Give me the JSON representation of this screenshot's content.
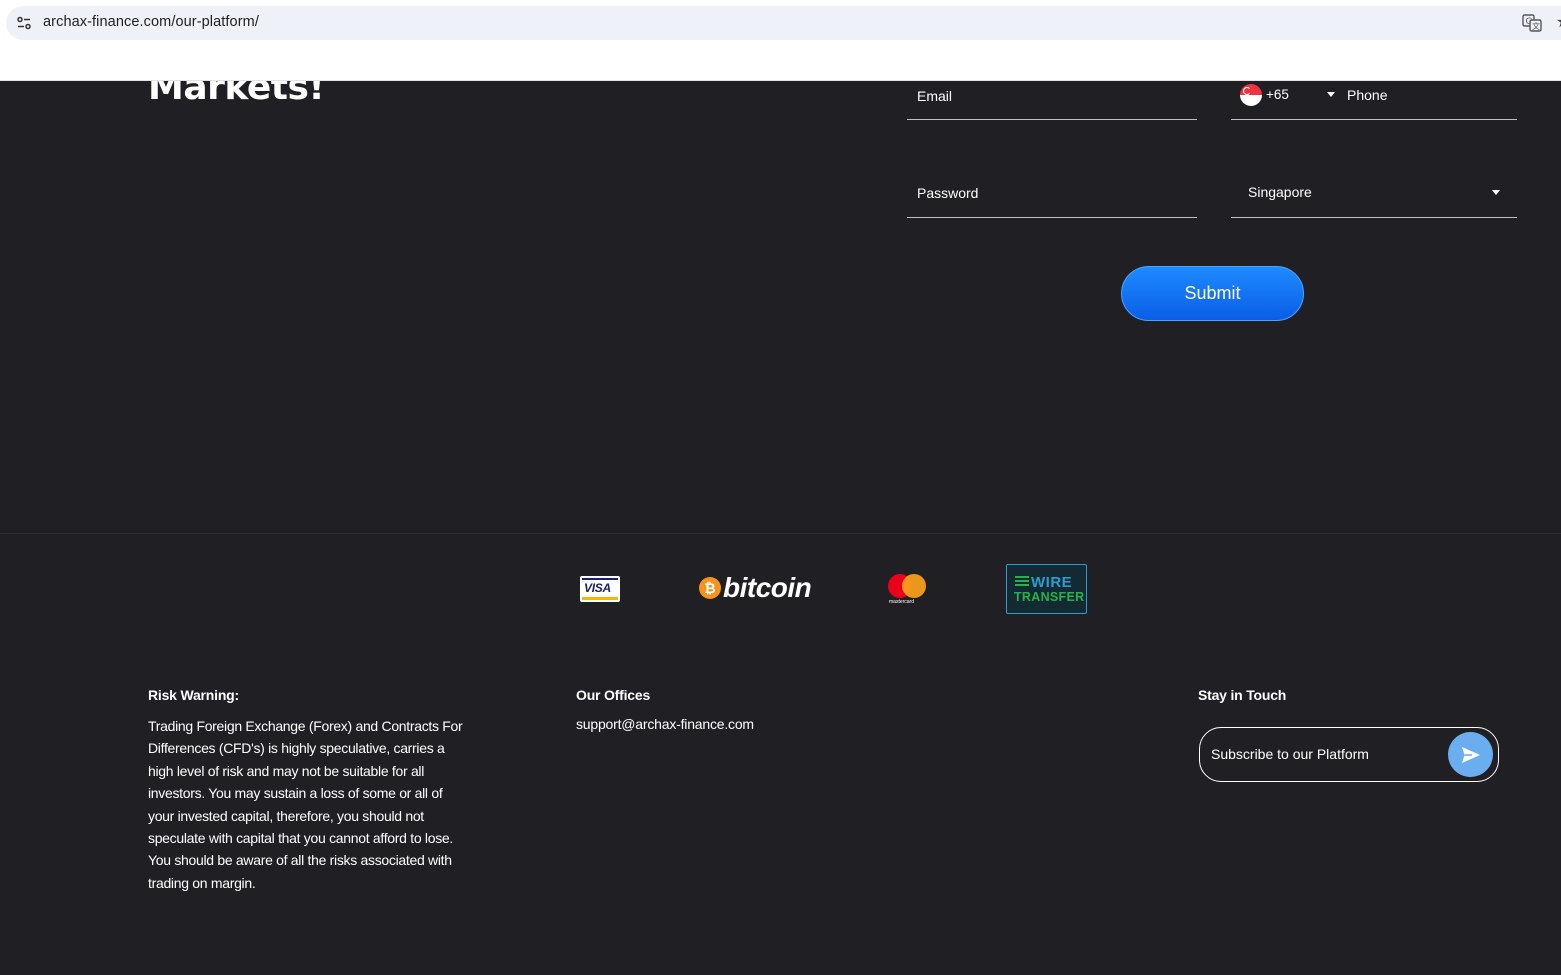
{
  "browser": {
    "url": "archax-finance.com/our-platform/"
  },
  "hero": {
    "title": "Markets!"
  },
  "form": {
    "email_label": "Email",
    "phone_dial_code": "+65",
    "phone_label": "Phone",
    "password_label": "Password",
    "country_selected": "Singapore",
    "submit_label": "Submit"
  },
  "payments": {
    "visa": "VISA",
    "bitcoin": "bitcoin",
    "bitcoin_symbol": "₿",
    "mastercard": "mastercard",
    "wire_top": "WIRE",
    "wire_bottom": "TRANSFER"
  },
  "footer": {
    "risk_title": "Risk Warning:",
    "risk_text": "Trading Foreign Exchange (Forex) and Contracts For Differences (CFD's) is highly speculative, carries a high level of risk and may not be suitable for all investors. You may sustain a loss of some or all of your invested capital, therefore, you should not speculate with capital that you cannot afford to lose. You should be aware of all the risks associated with trading on margin.",
    "offices_title": "Our Offices",
    "offices_email": "support@archax-finance.com",
    "touch_title": "Stay in Touch",
    "subscribe_placeholder": "Subscribe to our Platform"
  },
  "icons": {
    "site_info": "tune-icon",
    "translate": "translate-icon",
    "bookmark": "star-icon",
    "flag": "singapore-flag-icon",
    "send": "send-icon"
  },
  "colors": {
    "page_bg": "#202024",
    "accent": "#1e8bff",
    "send_button": "#6aaef0"
  }
}
